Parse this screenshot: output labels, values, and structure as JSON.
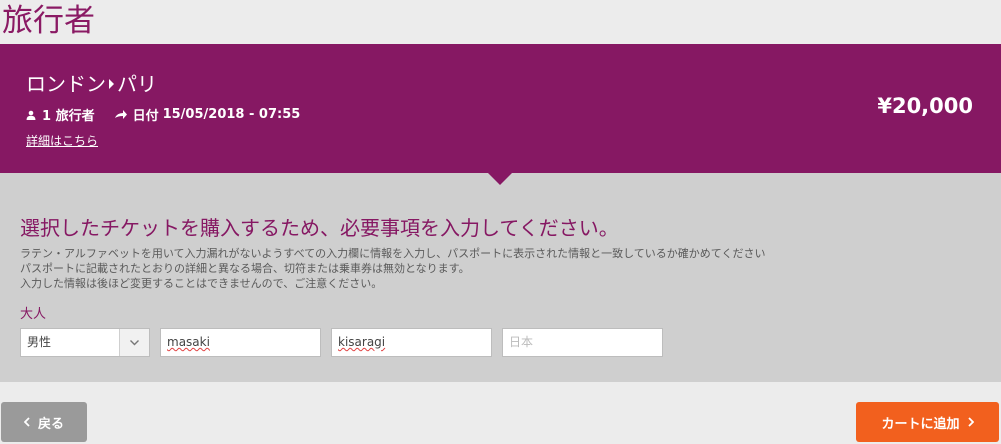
{
  "page": {
    "title": "旅行者"
  },
  "trip": {
    "origin": "ロンドン",
    "destination": "パリ",
    "travelers": "1 旅行者",
    "date_label": "日付",
    "date_value": "15/05/2018 - 07:55",
    "details_link": "詳細はこちら",
    "price": "¥20,000"
  },
  "form": {
    "heading": "選択したチケットを購入するため、必要事項を入力してください。",
    "instructions": [
      "ラテン・アルファベットを用いて入力漏れがないようすべての入力欄に情報を入力し、パスポートに表示された情報と一致しているか確かめてください",
      "パスポートに記載されたとおりの詳細と異なる場合、切符または乗車券は無効となります。",
      "入力した情報は後ほど変更することはできませんので、ご注意ください。"
    ],
    "passenger_category": "大人",
    "gender_selected": "男性",
    "first_name_value": "masaki",
    "last_name_value": "kisaragi",
    "country_placeholder": "日本"
  },
  "footer": {
    "back_label": "戻る",
    "add_to_cart_label": "カートに追加"
  },
  "colors": {
    "brand": "#861863",
    "accent": "#f2601e",
    "back_button": "#9a9a9a"
  },
  "icons": [
    "person-icon",
    "arrow-right-icon",
    "chevron-down-icon",
    "chevron-left-icon",
    "chevron-right-icon"
  ]
}
